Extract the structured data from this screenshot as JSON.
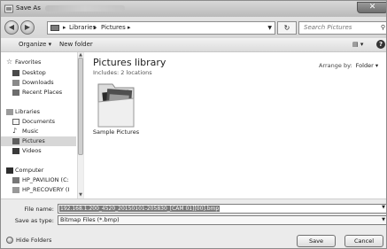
{
  "window": {
    "title": "Save As",
    "close_glyph": "✕"
  },
  "address": {
    "segments": [
      "Libraries",
      "Pictures"
    ],
    "separator": "▸",
    "search_placeholder": "Search Pictures"
  },
  "toolbar": {
    "organize": "Organize ▾",
    "new_folder": "New folder"
  },
  "nav": {
    "favorites_header": "Favorites",
    "favorites": [
      "Desktop",
      "Downloads",
      "Recent Places"
    ],
    "libraries_header": "Libraries",
    "libraries": [
      "Documents",
      "Music",
      "Pictures",
      "Videos"
    ],
    "computer_header": "Computer",
    "computer": [
      "HP_PAVILION (C:",
      "HP_RECOVERY (I"
    ],
    "selected": "Pictures"
  },
  "content": {
    "title": "Pictures library",
    "subtitle": "Includes: 2 locations",
    "arrange_label": "Arrange by:",
    "arrange_value": "Folder ▾",
    "items": [
      {
        "label": "Sample Pictures",
        "icon": "folder-icon"
      }
    ]
  },
  "form": {
    "filename_label": "File name:",
    "filename_value": "192.168.1.200_4520_20150101-205830_[CAM 01][00].bmp",
    "savetype_label": "Save as type:",
    "savetype_value": "Bitmap Files (*.bmp)"
  },
  "footer": {
    "hide_folders": "Hide Folders",
    "save": "Save",
    "cancel": "Cancel"
  }
}
